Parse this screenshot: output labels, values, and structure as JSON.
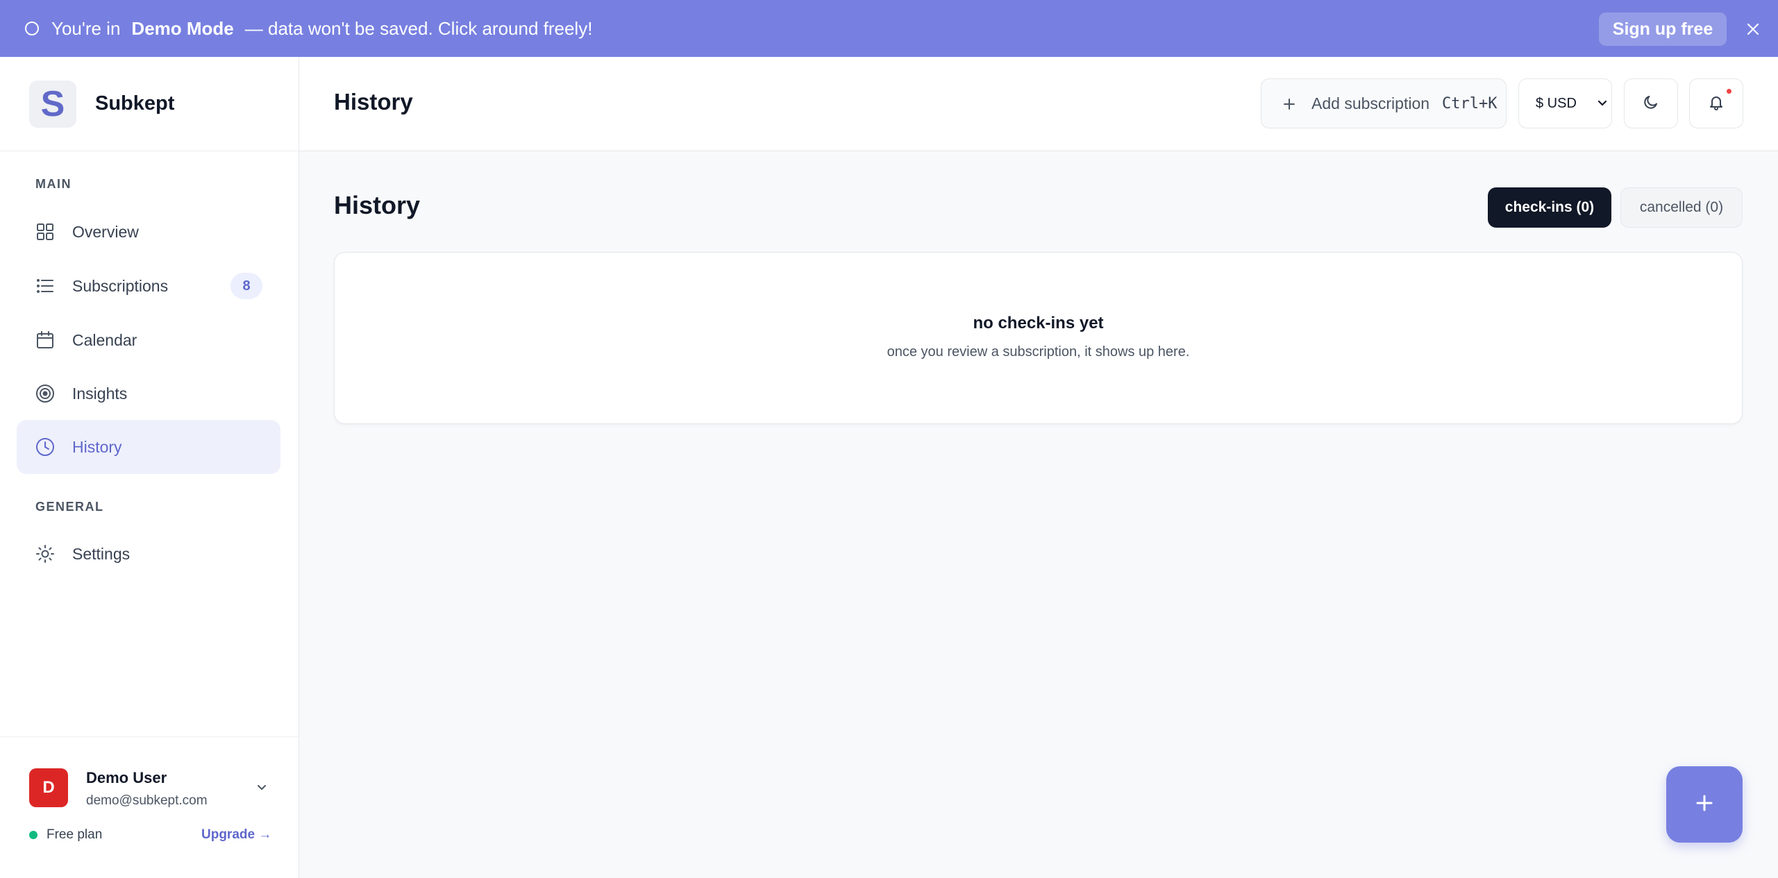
{
  "banner": {
    "prefix": "You're in",
    "mode": "Demo Mode",
    "suffix": "— data won't be saved. Click around freely!",
    "signup_label": "Sign up free"
  },
  "brand": {
    "logo_letter": "S",
    "name": "Subkept"
  },
  "sidebar": {
    "main_label": "MAIN",
    "general_label": "GENERAL",
    "items": [
      {
        "label": "Overview",
        "icon": "grid-icon"
      },
      {
        "label": "Subscriptions",
        "icon": "list-icon",
        "badge": "8"
      },
      {
        "label": "Calendar",
        "icon": "calendar-icon"
      },
      {
        "label": "Insights",
        "icon": "target-icon"
      },
      {
        "label": "History",
        "icon": "clock-icon",
        "active": true
      }
    ],
    "general_items": [
      {
        "label": "Settings",
        "icon": "sun-gear-icon"
      }
    ]
  },
  "user": {
    "initial": "D",
    "name": "Demo User",
    "email": "demo@subkept.com",
    "plan": "Free plan",
    "upgrade_label": "Upgrade →"
  },
  "header": {
    "title": "History",
    "add_label": "Add subscription",
    "shortcut": "Ctrl+K",
    "currency": "$ USD"
  },
  "main": {
    "title": "History",
    "tabs": [
      {
        "label": "check-ins (0)",
        "active": true
      },
      {
        "label": "cancelled (0)",
        "active": false
      }
    ],
    "empty_title": "no check-ins yet",
    "empty_subtitle": "once you review a subscription, it shows up here."
  },
  "colors": {
    "accent": "#7780e0",
    "accent_text": "#5f67cc",
    "dark": "#111827"
  }
}
